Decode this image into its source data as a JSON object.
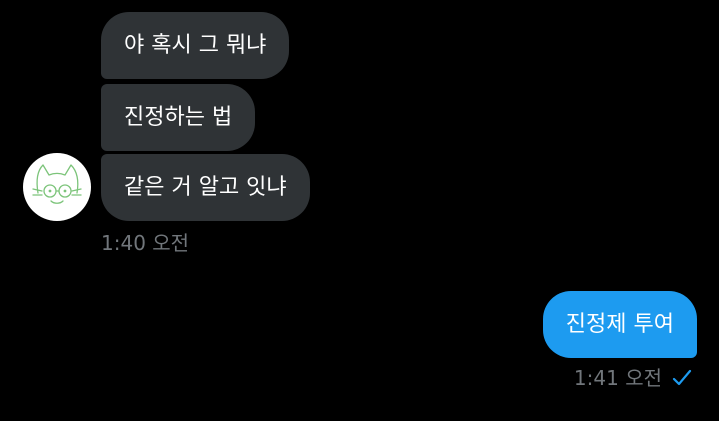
{
  "incoming": {
    "messages": [
      "야 혹시 그 뭐냐",
      "진정하는 법",
      "같은 거 알고 잇냐"
    ],
    "time": "1:40 오전",
    "avatar_icon": "cat-doodle-avatar"
  },
  "outgoing": {
    "messages": [
      "진정제 투여"
    ],
    "time": "1:41 오전",
    "status_icon": "sent-check-icon"
  },
  "colors": {
    "background": "#000000",
    "incoming_bubble": "#2f3336",
    "outgoing_bubble": "#1d9bf0",
    "timestamp": "#71767b",
    "checkmark": "#1d9bf0"
  }
}
